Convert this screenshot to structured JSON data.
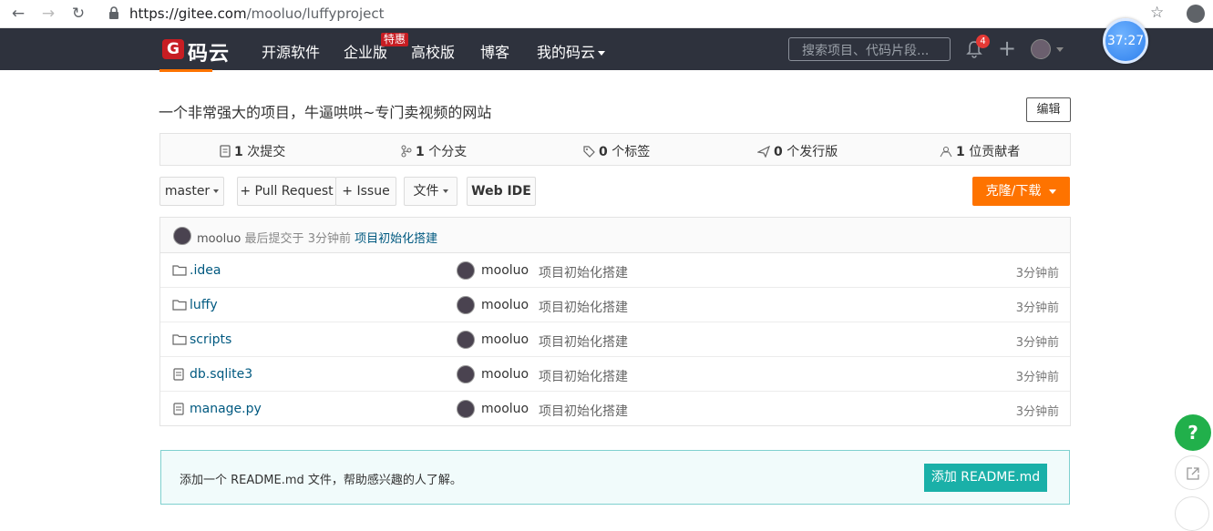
{
  "browser": {
    "url_host": "https://gitee.com",
    "url_path": "/mooluo/luffyproject"
  },
  "header": {
    "logo_text": "码云",
    "logo_mark": "G",
    "nav": [
      "开源软件",
      "企业版",
      "高校版",
      "博客",
      "我的码云"
    ],
    "enterprise_badge": "特惠",
    "search_placeholder": "搜索项目、代码片段...",
    "notification_count": "4"
  },
  "timer": "37:27",
  "repo": {
    "description": "一个非常强大的项目，牛逼哄哄~专门卖视频的网站",
    "edit_label": "编辑",
    "stats": [
      {
        "icon": "commit-icon",
        "count": "1",
        "label": "次提交"
      },
      {
        "icon": "branch-icon",
        "count": "1",
        "label": "个分支"
      },
      {
        "icon": "tag-icon",
        "count": "0",
        "label": "个标签"
      },
      {
        "icon": "release-icon",
        "count": "0",
        "label": "个发行版"
      },
      {
        "icon": "contributor-icon",
        "count": "1",
        "label": "位贡献者"
      }
    ],
    "toolbar": {
      "branch": "master",
      "pull_request": "+ Pull Request",
      "issue": "+ Issue",
      "file": "文件",
      "webide": "Web IDE",
      "clone": "克隆/下载"
    },
    "last_commit": {
      "author": "mooluo",
      "prefix": "最后提交于",
      "time": "3分钟前",
      "message": "项目初始化搭建"
    },
    "files": [
      {
        "type": "folder",
        "name": ".idea",
        "author": "mooluo",
        "message": "项目初始化搭建",
        "time": "3分钟前"
      },
      {
        "type": "folder",
        "name": "luffy",
        "author": "mooluo",
        "message": "项目初始化搭建",
        "time": "3分钟前"
      },
      {
        "type": "folder",
        "name": "scripts",
        "author": "mooluo",
        "message": "项目初始化搭建",
        "time": "3分钟前"
      },
      {
        "type": "file",
        "name": "db.sqlite3",
        "author": "mooluo",
        "message": "项目初始化搭建",
        "time": "3分钟前"
      },
      {
        "type": "file",
        "name": "manage.py",
        "author": "mooluo",
        "message": "项目初始化搭建",
        "time": "3分钟前"
      }
    ],
    "readme_notice": "添加一个 README.md 文件，帮助感兴趣的人了解。",
    "readme_button": "添加 README.md"
  },
  "float": {
    "help": "?"
  }
}
